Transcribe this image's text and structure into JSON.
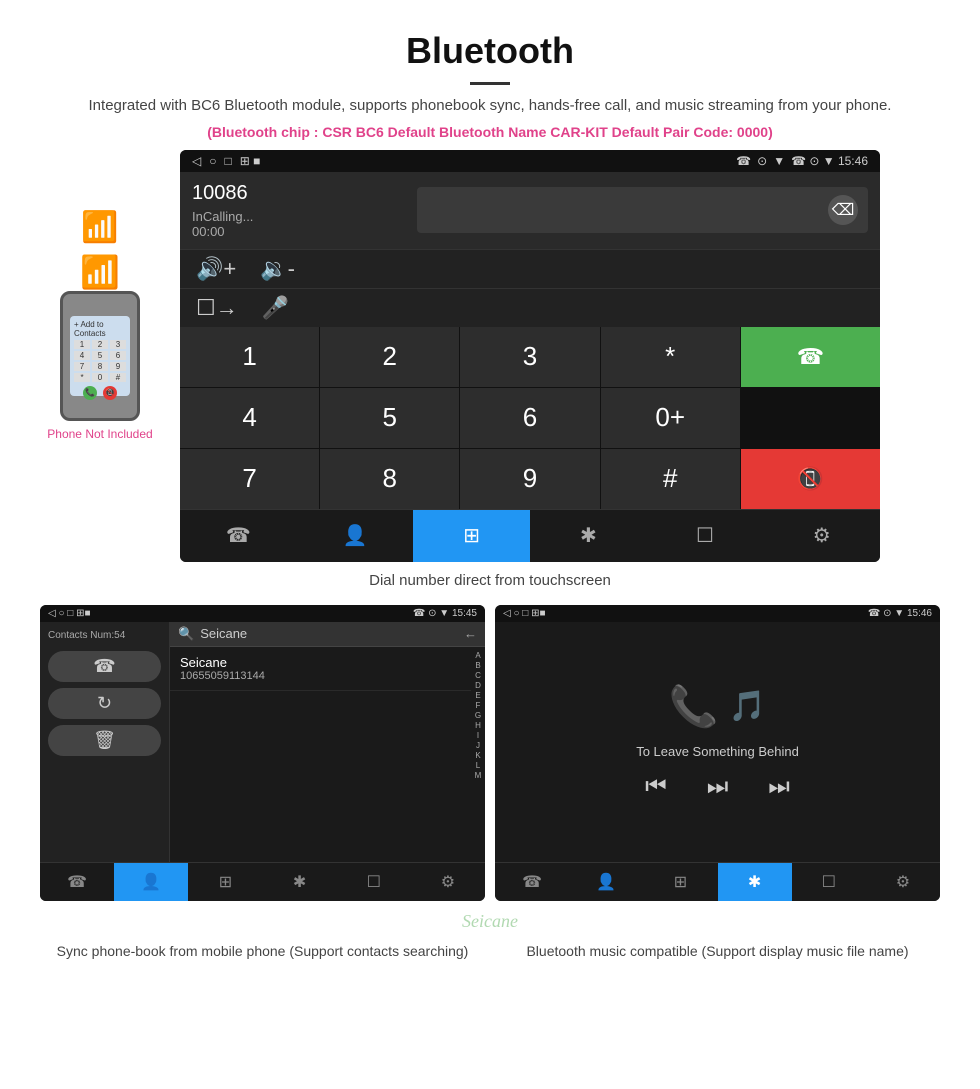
{
  "header": {
    "title": "Bluetooth",
    "description": "Integrated with BC6 Bluetooth module, supports phonebook sync, hands-free call, and music streaming from your phone.",
    "specs": "(Bluetooth chip : CSR BC6    Default Bluetooth Name CAR-KIT    Default Pair Code: 0000)"
  },
  "dial_screen": {
    "status_bar": {
      "left": "◁  ○  □  ⊞ ■",
      "right": "☎  ⊙  ▼  15:46"
    },
    "number": "10086",
    "calling_label": "InCalling...",
    "timer": "00:00",
    "keys": [
      "1",
      "2",
      "3",
      "*",
      "",
      "4",
      "5",
      "6",
      "0+",
      "",
      "7",
      "8",
      "9",
      "#",
      ""
    ],
    "green_label": "☎",
    "red_label": "☎",
    "backspace": "⌫",
    "bottom_nav": [
      "↙☎",
      "👤",
      "⊞",
      "✱",
      "☐→",
      "⚙"
    ],
    "active_nav_index": 2
  },
  "caption_main": "Dial number direct from touchscreen",
  "contacts_screen": {
    "status_bar_left": "◁  ○  □  ⊞■",
    "status_bar_right": "☎ ⊙ ▼ 15:45",
    "contacts_num": "Contacts Num:54",
    "actions": [
      "☎",
      "↻",
      "🗑"
    ],
    "search_placeholder": "Seicane",
    "contact": {
      "name": "Seicane",
      "number": "10655059113144"
    },
    "alpha": [
      "A",
      "B",
      "C",
      "D",
      "E",
      "F",
      "G",
      "H",
      "I",
      "J",
      "K",
      "L",
      "M"
    ],
    "bottom_nav": [
      "↙☎",
      "👤",
      "⊞",
      "✱",
      "☐→",
      "⚙"
    ],
    "active_nav_index": 1
  },
  "music_screen": {
    "status_bar_left": "◁  ○  □  ⊞■",
    "status_bar_right": "☎ ⊙ ▼ 15:46",
    "song_title": "To Leave Something Behind",
    "controls": [
      "⏮",
      "⏭",
      "⏭⏭"
    ],
    "bottom_nav": [
      "↙☎",
      "👤",
      "⊞",
      "✱",
      "☐→",
      "⚙"
    ],
    "active_nav_index": 3
  },
  "phone_aside": {
    "not_included": "Phone Not Included"
  },
  "bottom_captions": {
    "left": "Sync phone-book from mobile phone\n(Support contacts searching)",
    "right": "Bluetooth music compatible\n(Support display music file name)"
  },
  "watermark": "Seicane"
}
